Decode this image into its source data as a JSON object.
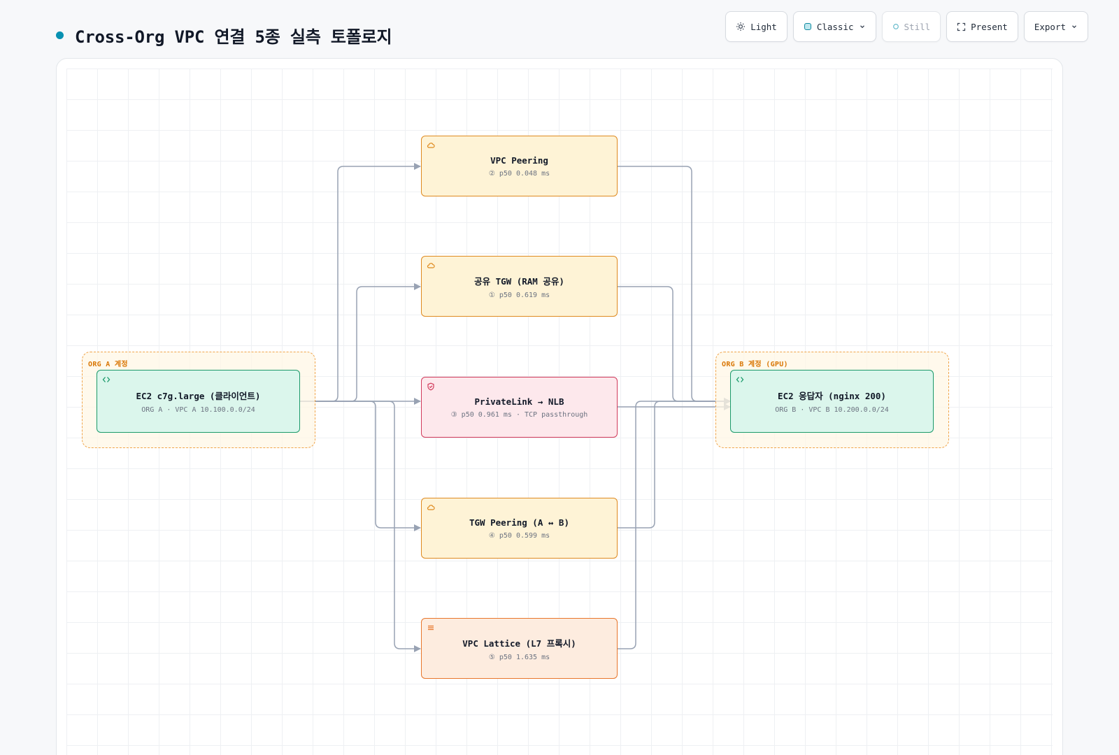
{
  "page": {
    "title": "Cross-Org VPC 연결 5종 실측 토폴로지"
  },
  "toolbar": {
    "light_label": "Light",
    "classic_label": "Classic",
    "still_label": "Still",
    "present_label": "Present",
    "export_label": "Export"
  },
  "colors": {
    "accent_dot": "#0891b2",
    "edge": "#98a2b3",
    "group_border": "#f0a44a",
    "amber": "#df8a1f",
    "rose": "#d23a5b",
    "peach": "#e8762b",
    "green": "#1a9a6a"
  },
  "groups": {
    "org_a": {
      "label": "ORG A 계정"
    },
    "org_b": {
      "label": "ORG B 계정 (GPU)"
    }
  },
  "nodes": {
    "client": {
      "icon": "code-icon",
      "title": "EC2 c7g.large (클라이언트)",
      "subtitle": "ORG A · VPC A 10.100.0.0/24"
    },
    "vpc_peering": {
      "icon": "cloud-icon",
      "title": "VPC Peering",
      "subtitle": "② p50 0.048 ms"
    },
    "shared_tgw": {
      "icon": "cloud-icon",
      "title": "공유 TGW (RAM 공유)",
      "subtitle": "① p50 0.619 ms"
    },
    "privatelink": {
      "icon": "shield-icon",
      "title": "PrivateLink → NLB",
      "subtitle": "③ p50 0.961 ms · TCP passthrough"
    },
    "tgw_peering": {
      "icon": "cloud-icon",
      "title": "TGW Peering (A ↔ B)",
      "subtitle": "④ p50 0.599 ms"
    },
    "lattice": {
      "icon": "menu-icon",
      "title": "VPC Lattice (L7 프록시)",
      "subtitle": "⑤ p50 1.635 ms"
    },
    "responder": {
      "icon": "code-icon",
      "title": "EC2 응답자 (nginx 200)",
      "subtitle": "ORG B · VPC B 10.200.0.0/24"
    }
  },
  "edges": [
    {
      "from": "client",
      "to": "vpc_peering"
    },
    {
      "from": "client",
      "to": "shared_tgw"
    },
    {
      "from": "client",
      "to": "privatelink"
    },
    {
      "from": "client",
      "to": "tgw_peering"
    },
    {
      "from": "client",
      "to": "lattice"
    },
    {
      "from": "vpc_peering",
      "to": "responder"
    },
    {
      "from": "shared_tgw",
      "to": "responder"
    },
    {
      "from": "privatelink",
      "to": "responder"
    },
    {
      "from": "tgw_peering",
      "to": "responder"
    },
    {
      "from": "lattice",
      "to": "responder"
    }
  ]
}
